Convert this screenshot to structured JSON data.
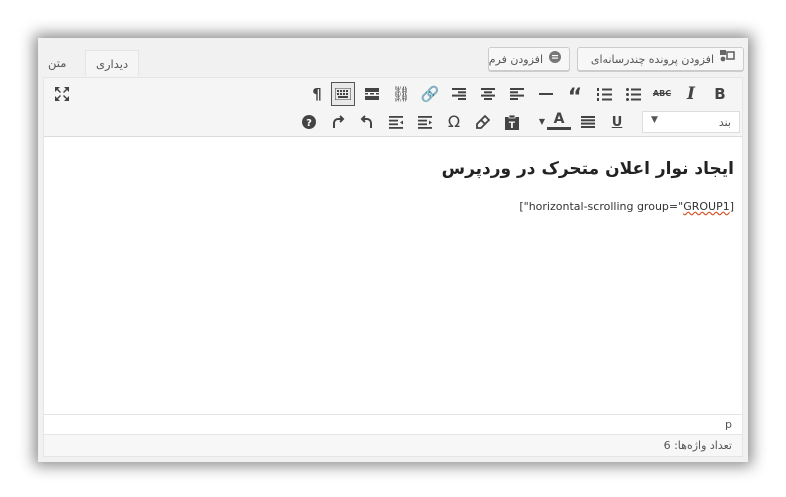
{
  "media_buttons": {
    "add_media_label": "افزودن پرونده چندرسانه‌ای",
    "add_form_label": "افزودن فرم"
  },
  "tabs": {
    "visual": "دیداری",
    "text": "متن"
  },
  "toolbar": {
    "format_select_value": "بند",
    "row1_icons": [
      "bold-icon",
      "italic-icon",
      "strikethrough-icon",
      "bulleted-list-icon",
      "numbered-list-icon",
      "blockquote-icon",
      "horizontal-line-icon",
      "align-left-icon",
      "align-center-icon",
      "align-right-icon",
      "insert-link-icon",
      "remove-link-icon",
      "read-more-icon",
      "toolbar-toggle-icon",
      "paragraph-direction-icon",
      "fullscreen-icon"
    ],
    "row2_icons": [
      "format-select",
      "underline-icon",
      "justify-icon",
      "text-color-icon",
      "paste-as-text-icon",
      "clear-formatting-icon",
      "special-character-icon",
      "outdent-icon",
      "indent-icon",
      "undo-icon",
      "redo-icon",
      "help-icon"
    ]
  },
  "content": {
    "heading": "ایجاد نوار اعلان متحرک در وردپرس",
    "shortcode_prefix": "[\"horizontal-scrolling group=\"",
    "shortcode_word": "GROUP1",
    "shortcode_suffix": "]"
  },
  "path": "p",
  "word_count": "تعداد واژه‌ها: 6",
  "colors": {
    "accent_red": "#d54e21",
    "toolbar_bg": "#f5f5f5",
    "frame_bg": "#f1f1f1"
  }
}
